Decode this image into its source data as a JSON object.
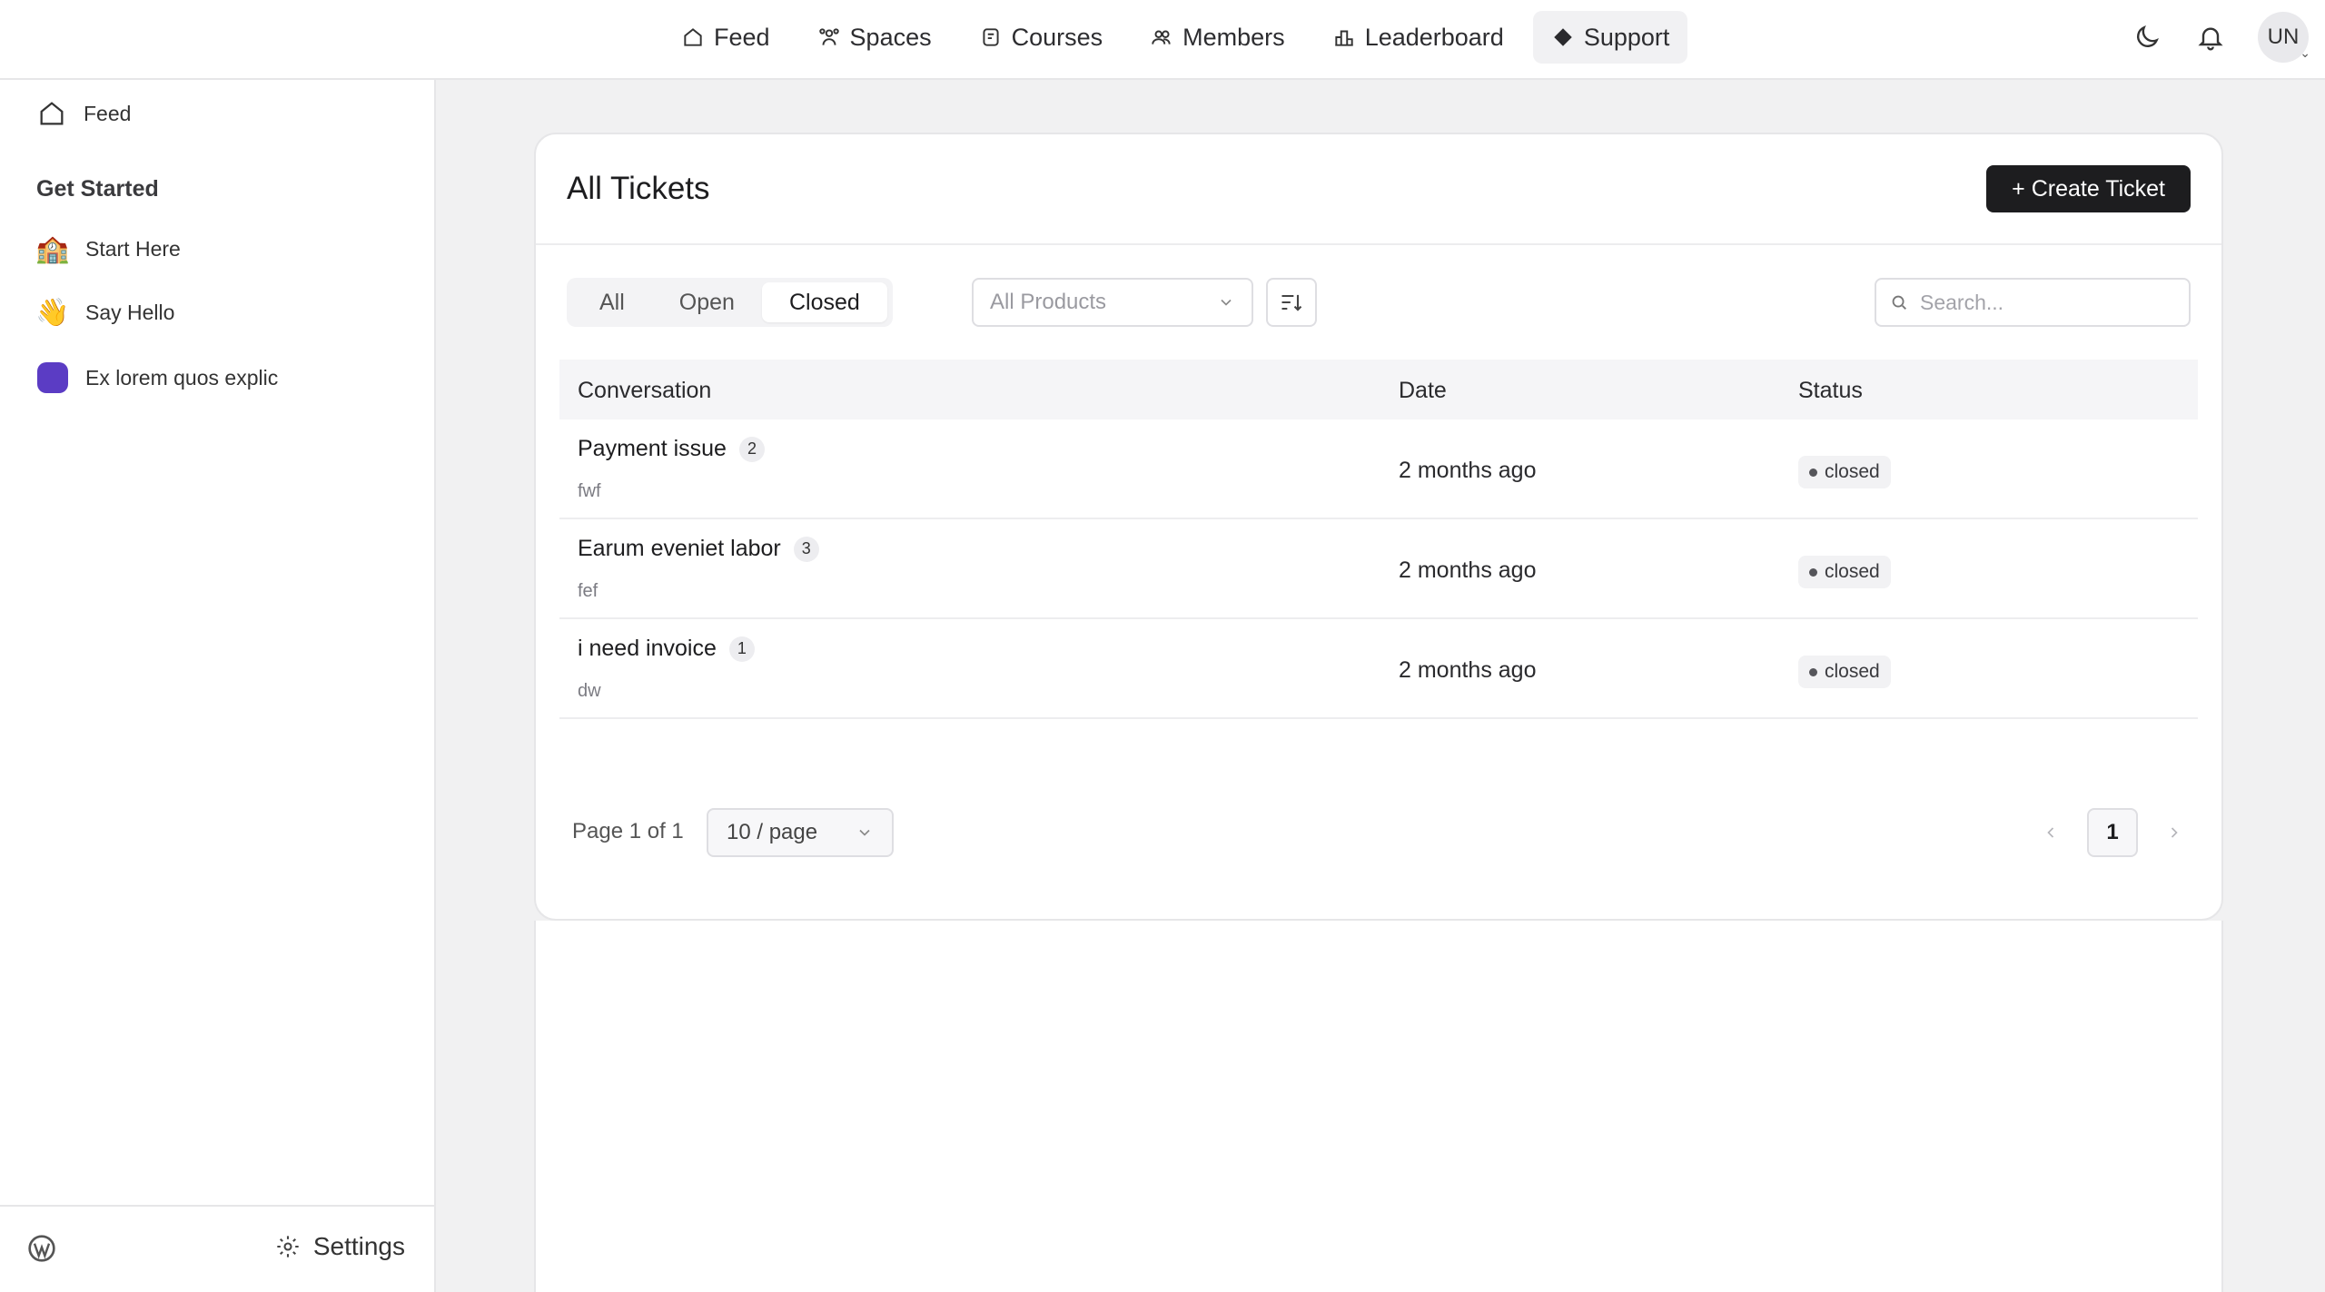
{
  "nav": {
    "items": [
      {
        "label": "Feed",
        "icon": "home-icon"
      },
      {
        "label": "Spaces",
        "icon": "spaces-icon"
      },
      {
        "label": "Courses",
        "icon": "courses-icon"
      },
      {
        "label": "Members",
        "icon": "members-icon"
      },
      {
        "label": "Leaderboard",
        "icon": "leaderboard-icon"
      },
      {
        "label": "Support",
        "icon": "diamond-icon"
      }
    ],
    "active": "Support"
  },
  "user": {
    "initials": "UN"
  },
  "sidebar": {
    "feed_label": "Feed",
    "heading": "Get Started",
    "items": [
      {
        "label": "Start Here",
        "icon": "🏫"
      },
      {
        "label": "Say Hello",
        "icon": "👋"
      },
      {
        "label": "Ex lorem quos explic",
        "color": "#5b3cc4"
      }
    ],
    "settings_label": "Settings"
  },
  "tickets": {
    "title": "All Tickets",
    "create_label": "+ Create Ticket",
    "tabs": [
      "All",
      "Open",
      "Closed"
    ],
    "active_tab": "Closed",
    "products_placeholder": "All Products",
    "search_placeholder": "Search...",
    "columns": [
      "Conversation",
      "Date",
      "Status"
    ],
    "rows": [
      {
        "title": "Payment issue",
        "count": "2",
        "sub": "fwf",
        "date": "2 months ago",
        "status": "closed"
      },
      {
        "title": "Earum eveniet labor",
        "count": "3",
        "sub": "fef",
        "date": "2 months ago",
        "status": "closed"
      },
      {
        "title": "i need invoice",
        "count": "1",
        "sub": "dw",
        "date": "2 months ago",
        "status": "closed"
      }
    ],
    "page_info": "Page 1 of 1",
    "per_page": "10 / page",
    "current_page": "1"
  }
}
